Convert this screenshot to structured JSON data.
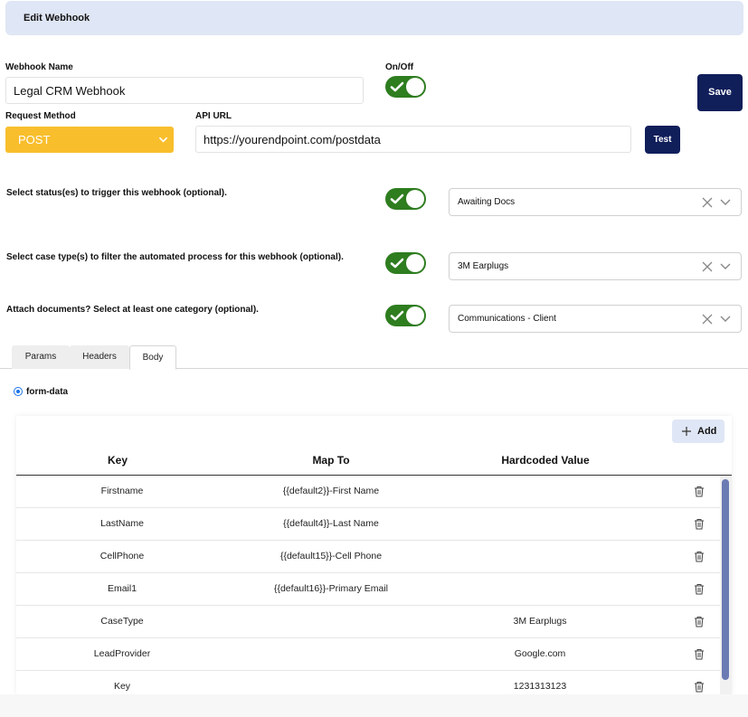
{
  "header": {
    "title": "Edit Webhook"
  },
  "form": {
    "webhook_name_label": "Webhook Name",
    "webhook_name_value": "Legal CRM Webhook",
    "onoff_label": "On/Off",
    "save_label": "Save",
    "request_method_label": "Request Method",
    "request_method_value": "POST",
    "api_url_label": "API URL",
    "api_url_value": "https://yourendpoint.com/postdata",
    "test_label": "Test"
  },
  "options": [
    {
      "question": "Select status(es) to trigger this webhook (optional).",
      "value": "Awaiting Docs"
    },
    {
      "question": "Select case type(s) to filter the automated process for this webhook (optional).",
      "value": "3M Earplugs"
    },
    {
      "question": "Attach documents? Select at least one category (optional).",
      "value": "Communications - Client"
    }
  ],
  "tabs": [
    {
      "label": "Params",
      "active": false
    },
    {
      "label": "Headers",
      "active": false
    },
    {
      "label": "Body",
      "active": true
    }
  ],
  "body": {
    "radio_label": "form-data",
    "add_label": "Add",
    "columns": {
      "key": "Key",
      "map_to": "Map To",
      "hardcoded": "Hardcoded Value"
    },
    "rows": [
      {
        "key": "Firstname",
        "map_to": "{{default2}}-First Name",
        "hardcoded": ""
      },
      {
        "key": "LastName",
        "map_to": "{{default4}}-Last Name",
        "hardcoded": ""
      },
      {
        "key": "CellPhone",
        "map_to": "{{default15}}-Cell Phone",
        "hardcoded": ""
      },
      {
        "key": "Email1",
        "map_to": "{{default16}}-Primary Email",
        "hardcoded": ""
      },
      {
        "key": "CaseType",
        "map_to": "",
        "hardcoded": "3M Earplugs"
      },
      {
        "key": "LeadProvider",
        "map_to": "",
        "hardcoded": "Google.com"
      },
      {
        "key": "Key",
        "map_to": "",
        "hardcoded": "1231313123"
      }
    ]
  },
  "colors": {
    "toggle_on": "#2e7d1f",
    "primary_dark": "#101e5a",
    "method_select": "#f8be2c",
    "header_bg": "#dfe6f5",
    "scroll_thumb": "#6b7bb3"
  },
  "icons": {
    "toggle": "check-icon",
    "clear": "close-icon",
    "dropdown": "chevron-down-icon",
    "add": "plus-icon",
    "delete": "trash-icon"
  }
}
